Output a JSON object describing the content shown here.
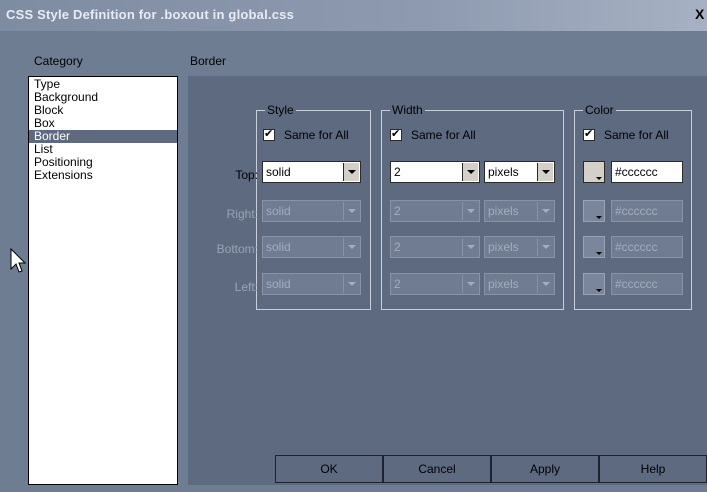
{
  "window": {
    "title": "CSS Style Definition for .boxout in global.css",
    "close_label": "X"
  },
  "category_label": "Category",
  "categories": [
    "Type",
    "Background",
    "Block",
    "Box",
    "Border",
    "List",
    "Positioning",
    "Extensions"
  ],
  "selected_category": "Border",
  "section_title": "Border",
  "groups": {
    "style": {
      "title": "Style",
      "same_for_all": "Same for All",
      "checked": true
    },
    "width": {
      "title": "Width",
      "same_for_all": "Same for All",
      "checked": true
    },
    "color": {
      "title": "Color",
      "same_for_all": "Same for All",
      "checked": true
    }
  },
  "rows": [
    {
      "label": "Top:",
      "style": "solid",
      "width": "2",
      "unit": "pixels",
      "color": "#cccccc",
      "enabled": true
    },
    {
      "label": "Right:",
      "style": "solid",
      "width": "2",
      "unit": "pixels",
      "color": "#cccccc",
      "enabled": false
    },
    {
      "label": "Bottom:",
      "style": "solid",
      "width": "2",
      "unit": "pixels",
      "color": "#cccccc",
      "enabled": false
    },
    {
      "label": "Left:",
      "style": "solid",
      "width": "2",
      "unit": "pixels",
      "color": "#cccccc",
      "enabled": false
    }
  ],
  "buttons": {
    "ok": "OK",
    "cancel": "Cancel",
    "apply": "Apply",
    "help": "Help"
  }
}
